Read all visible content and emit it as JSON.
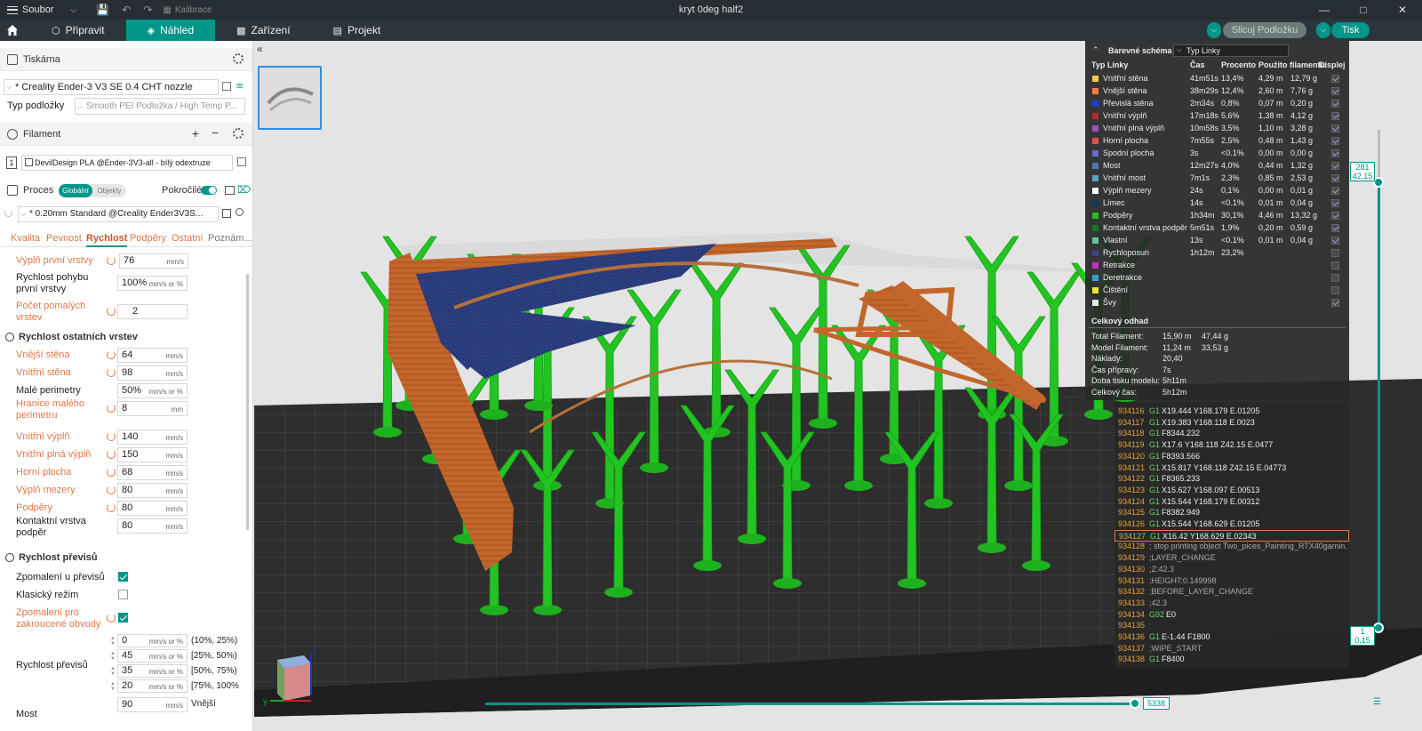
{
  "titlebar": {
    "menu_label": "Soubor",
    "calibration_label": "Kalibrace",
    "project_title": "kryt 0deg half2"
  },
  "topbar": {
    "tabs": [
      {
        "label": "Připravit"
      },
      {
        "label": "Náhled"
      },
      {
        "label": "Zařízení"
      },
      {
        "label": "Projekt"
      }
    ],
    "slice_label": "Slicuj Podložku",
    "print_label": "Tisk"
  },
  "left": {
    "printer_header": "Tiskárna",
    "printer_value": "* Creality Ender-3 V3 SE 0.4 CHT nozzle",
    "plate_label": "Typ podložky",
    "plate_value": "Smooth PEI Podložka / High Temp P...",
    "filament_header": "Filament",
    "filament_index": "1",
    "filament_value": "DevilDesign PLA @Ender-3V3-all - bílý odextruze",
    "process_header": "Proces",
    "toggle_global": "Globální",
    "toggle_objects": "Objekty",
    "advanced_label": "Pokročilé",
    "process_value": "* 0.20mm Standard @Creality Ender3V3S...",
    "subtabs": [
      "Kvalita",
      "Pevnost",
      "Rychlost",
      "Podpěry",
      "Ostatní",
      "Poznám..."
    ],
    "active_subtab": "Rychlost",
    "settings": [
      {
        "label": "Výplň první vrstvy",
        "value": "76",
        "unit": "mm/s"
      },
      {
        "label": "Rychlost pohybu první vrstvy",
        "value": "100%",
        "unit": "mm/s or %"
      },
      {
        "label": "Počet pomalých vrstev",
        "value": "2",
        "unit": ""
      }
    ],
    "group2_title": "Rychlost ostatních vrstev",
    "settings2": [
      {
        "label": "Vnější stěna",
        "value": "64",
        "unit": "mm/s"
      },
      {
        "label": "Vnitřní stěna",
        "value": "98",
        "unit": "mm/s"
      },
      {
        "label": "Malé perimetry",
        "value": "50%",
        "unit": "mm/s or %"
      },
      {
        "label": "Hranice malého perimetru",
        "value": "8",
        "unit": "mm"
      },
      {
        "label": "Vnitřní výplň",
        "value": "140",
        "unit": "mm/s"
      },
      {
        "label": "Vnitřní plná výplň",
        "value": "150",
        "unit": "mm/s"
      },
      {
        "label": "Horní plocha",
        "value": "68",
        "unit": "mm/s"
      },
      {
        "label": "Výplň mezery",
        "value": "80",
        "unit": "mm/s"
      },
      {
        "label": "Podpěry",
        "value": "80",
        "unit": "mm/s"
      },
      {
        "label": "Kontaktní vrstva podpěr",
        "value": "80",
        "unit": "mm/s"
      }
    ],
    "group3_title": "Rychlost převisů",
    "checks": [
      {
        "label": "Zpomalení u převisů",
        "checked": true
      },
      {
        "label": "Klasický režim",
        "checked": false
      },
      {
        "label": "Zpomalení pro zakroucené obvody",
        "checked": true
      }
    ],
    "overhang_label": "Rychlost převisů",
    "overhang_rows": [
      {
        "value": "0",
        "unit": "mm/s or %",
        "range": "(10%, 25%)"
      },
      {
        "value": "45",
        "unit": "mm/s or %",
        "range": "[25%, 50%)"
      },
      {
        "value": "35",
        "unit": "mm/s or %",
        "range": "[50%, 75%)"
      },
      {
        "value": "20",
        "unit": "mm/s or %",
        "range": "[75%, 100%"
      }
    ],
    "bridge_label": "Most",
    "bridge_value": "90",
    "bridge_unit": "mm/s",
    "bridge_suffix": "Vnější"
  },
  "legend": {
    "title": "Barevné schéma",
    "dropdown": "Typ Linky",
    "headers": [
      "Typ Linky",
      "Čas",
      "Procento",
      "Použito filamentu",
      "Displej"
    ],
    "rows": [
      {
        "name": "Vnitřní stěna",
        "time": "41m51s",
        "pct": "13,4%",
        "len": "4,29 m",
        "g": "12,79 g",
        "color": "#f2c94c",
        "on": true
      },
      {
        "name": "Vnější stěna",
        "time": "38m29s",
        "pct": "12,4%",
        "len": "2,60 m",
        "g": "7,76 g",
        "color": "#f07f3c",
        "on": true
      },
      {
        "name": "Převislá stěna",
        "time": "2m34s",
        "pct": "0,8%",
        "len": "0,07 m",
        "g": "0,20 g",
        "color": "#1c3cd8",
        "on": true
      },
      {
        "name": "Vnitřní výplň",
        "time": "17m18s",
        "pct": "5,6%",
        "len": "1,38 m",
        "g": "4,12 g",
        "color": "#b0302a",
        "on": true
      },
      {
        "name": "Vnitřní plná výplň",
        "time": "10m58s",
        "pct": "3,5%",
        "len": "1,10 m",
        "g": "3,28 g",
        "color": "#9b4fc6",
        "on": true
      },
      {
        "name": "Horní plocha",
        "time": "7m55s",
        "pct": "2,5%",
        "len": "0,48 m",
        "g": "1,43 g",
        "color": "#e05050",
        "on": true
      },
      {
        "name": "Spodní plocha",
        "time": "3s",
        "pct": "<0.1%",
        "len": "0,00 m",
        "g": "0,00 g",
        "color": "#6a6ad0",
        "on": true
      },
      {
        "name": "Most",
        "time": "12m27s",
        "pct": "4,0%",
        "len": "0,44 m",
        "g": "1,32 g",
        "color": "#5078b8",
        "on": true
      },
      {
        "name": "Vnitřní most",
        "time": "7m1s",
        "pct": "2,3%",
        "len": "0,85 m",
        "g": "2,53 g",
        "color": "#5fa0c8",
        "on": true
      },
      {
        "name": "Výplň mezery",
        "time": "24s",
        "pct": "0,1%",
        "len": "0,00 m",
        "g": "0,01 g",
        "color": "#ffffff",
        "on": true
      },
      {
        "name": "Límec",
        "time": "14s",
        "pct": "<0.1%",
        "len": "0,01 m",
        "g": "0,04 g",
        "color": "#0c3a5a",
        "on": true
      },
      {
        "name": "Podpěry",
        "time": "1h34m",
        "pct": "30,1%",
        "len": "4,46 m",
        "g": "13,32 g",
        "color": "#22c422",
        "on": true
      },
      {
        "name": "Kontaktní vrstva podpěr",
        "time": "5m51s",
        "pct": "1,9%",
        "len": "0,20 m",
        "g": "0,59 g",
        "color": "#0e7a2a",
        "on": true
      },
      {
        "name": "Vlastní",
        "time": "13s",
        "pct": "<0.1%",
        "len": "0,01 m",
        "g": "0,04 g",
        "color": "#5ec8a0",
        "on": true
      },
      {
        "name": "Rychloposun",
        "time": "1h12m",
        "pct": "23,2%",
        "len": "",
        "g": "",
        "color": "#40408a",
        "on": false
      },
      {
        "name": "Retrakce",
        "time": "",
        "pct": "",
        "len": "",
        "g": "",
        "color": "#c030c0",
        "on": false
      },
      {
        "name": "Deretrakce",
        "time": "",
        "pct": "",
        "len": "",
        "g": "",
        "color": "#3aa0d0",
        "on": false
      },
      {
        "name": "Čištění",
        "time": "",
        "pct": "",
        "len": "",
        "g": "",
        "color": "#f0e030",
        "on": false
      },
      {
        "name": "Švy",
        "time": "",
        "pct": "",
        "len": "",
        "g": "",
        "color": "#e8e8e8",
        "on": true
      }
    ],
    "estimate_title": "Celkový odhad",
    "estimates": [
      {
        "label": "Total Filament:",
        "v1": "15,90 m",
        "v2": "47,44 g"
      },
      {
        "label": "Model Filament:",
        "v1": "11,24 m",
        "v2": "33,53 g"
      },
      {
        "label": "Náklady:",
        "v1": "20,40",
        "v2": ""
      },
      {
        "label": "Čas přípravy:",
        "v1": "7s",
        "v2": ""
      },
      {
        "label": "Doba tisku modelu:",
        "v1": "5h11m",
        "v2": ""
      },
      {
        "label": "Celkový čas:",
        "v1": "5h12m",
        "v2": ""
      }
    ]
  },
  "gcode": [
    {
      "ln": "934116",
      "cmd": "G1",
      "arg": "X19.444 Y168.179 E.01205"
    },
    {
      "ln": "934117",
      "cmd": "G1",
      "arg": "X19.383 Y168.118 E.0023"
    },
    {
      "ln": "934118",
      "cmd": "G1",
      "arg": "F8344.232"
    },
    {
      "ln": "934119",
      "cmd": "G1",
      "arg": "X17.6 Y168.118 Z42.15 E.0477"
    },
    {
      "ln": "934120",
      "cmd": "G1",
      "arg": "F8393.566"
    },
    {
      "ln": "934121",
      "cmd": "G1",
      "arg": "X15.817 Y168.118 Z42.15 E.04773"
    },
    {
      "ln": "934122",
      "cmd": "G1",
      "arg": "F8365.233"
    },
    {
      "ln": "934123",
      "cmd": "G1",
      "arg": "X15.627 Y168.097 E.00513"
    },
    {
      "ln": "934124",
      "cmd": "G1",
      "arg": "X15.544 Y168.179 E.00312"
    },
    {
      "ln": "934125",
      "cmd": "G1",
      "arg": "F8382.949"
    },
    {
      "ln": "934126",
      "cmd": "G1",
      "arg": "X15.544 Y168.629 E.01205"
    },
    {
      "ln": "934127",
      "cmd": "G1",
      "arg": "X16.42 Y168.629 E.02343"
    },
    {
      "ln": "934128",
      "cmd": "",
      "arg": "; stop printing object Two_pices_Painting_RTX40gamin..."
    },
    {
      "ln": "934129",
      "cmd": "",
      "arg": ";LAYER_CHANGE"
    },
    {
      "ln": "934130",
      "cmd": "",
      "arg": ";Z:42.3"
    },
    {
      "ln": "934131",
      "cmd": "",
      "arg": ";HEIGHT:0.149998"
    },
    {
      "ln": "934132",
      "cmd": "",
      "arg": ";BEFORE_LAYER_CHANGE"
    },
    {
      "ln": "934133",
      "cmd": "",
      "arg": ";42.3"
    },
    {
      "ln": "934134",
      "cmd": "G92",
      "arg": "E0"
    },
    {
      "ln": "934135",
      "cmd": "",
      "arg": ""
    },
    {
      "ln": "934136",
      "cmd": "G1",
      "arg": "E-1.44 F1800"
    },
    {
      "ln": "934137",
      "cmd": "",
      "arg": ";WIPE_START"
    },
    {
      "ln": "934138",
      "cmd": "G1",
      "arg": "F8400"
    }
  ],
  "gcode_highlight_index": 11,
  "layer_slider": {
    "top_layer": "281",
    "top_height": "42,15",
    "bottom_layer": "1",
    "bottom_height": "0,15"
  },
  "move_slider": {
    "value": "5338"
  },
  "axes": {
    "x": "x",
    "y": "y",
    "z": "z"
  },
  "colors": {
    "accent": "#009688",
    "support": "#22c422",
    "outer_wall": "#c8682e",
    "bridge": "#2a3a7a",
    "bed": "#2e2e2e"
  }
}
